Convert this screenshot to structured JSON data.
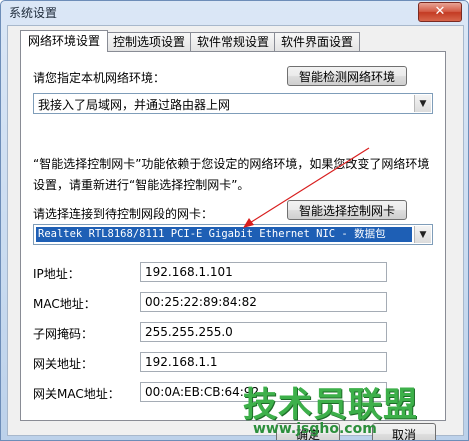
{
  "window": {
    "title": "系统设置",
    "close_label": "✕"
  },
  "tabs": [
    {
      "label": "网络环境设置",
      "active": true
    },
    {
      "label": "控制选项设置",
      "active": false
    },
    {
      "label": "软件常规设置",
      "active": false
    },
    {
      "label": "软件界面设置",
      "active": false
    }
  ],
  "network": {
    "env_label": "请您指定本机网络环境：",
    "detect_button": "智能检测网络环境",
    "env_value": "我接入了局域网，并通过路由器上网",
    "notice": "“智能选择控制网卡”功能依赖于您设定的网络环境，如果您改变了网络环境设置，请重新进行“智能选择控制网卡”。",
    "nic_label": "请选择连接到待控制网段的网卡：",
    "nic_button": "智能选择控制网卡",
    "nic_value": "Realtek RTL8168/8111 PCI-E Gigabit Ethernet NIC - 数据包",
    "fields": [
      {
        "label": "IP地址：",
        "value": "192.168.1.101"
      },
      {
        "label": "MAC地址：",
        "value": "00:25:22:89:84:82"
      },
      {
        "label": "子网掩码：",
        "value": "255.255.255.0"
      },
      {
        "label": "网关地址：",
        "value": "192.168.1.1"
      },
      {
        "label": "网关MAC地址：",
        "value": "00:0A:EB:CB:64:92"
      }
    ]
  },
  "footer": {
    "ok_label": "确定",
    "cancel_label": "取消"
  },
  "watermark": {
    "text": "技术员联盟",
    "url": "www.jsgho.com"
  },
  "colors": {
    "selection": "#1e5fb5",
    "arrow": "#d81e1e",
    "watermark": "#3db04a"
  }
}
